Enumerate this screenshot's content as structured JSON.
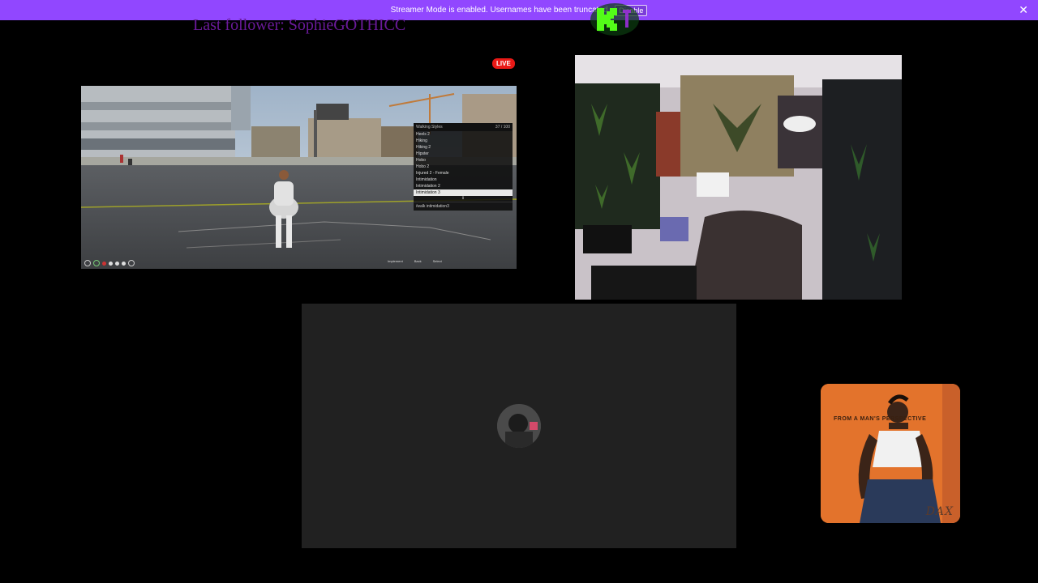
{
  "banner": {
    "message": "Streamer Mode is enabled. Usernames have been truncated.",
    "disable_label": "Disable",
    "close_glyph": "✕",
    "color": "#9147ff"
  },
  "overlay": {
    "last_follower": "Last follower: SophieGOTHICC",
    "live_label": "LIVE",
    "kick_logo_letter": "K"
  },
  "game_menu": {
    "title": "Walking Styles",
    "counter": "37 / 100",
    "items": [
      "Heels 2",
      "Hiking",
      "Hiking 2",
      "Hipster",
      "Hobo",
      "Hobo 2",
      "Injured 2 - Female",
      "Intimidation",
      "Intimidation 2",
      "Intimidation 3"
    ],
    "selected_index": 9,
    "footer": "/walk intimidation3"
  },
  "game_hud": {
    "right_labels": [
      "Implement",
      "Back",
      "Select"
    ]
  },
  "album": {
    "tagline": "FROM A MAN'S PERSPECTIVE",
    "artist": "DAX",
    "color": "#e3732c"
  }
}
